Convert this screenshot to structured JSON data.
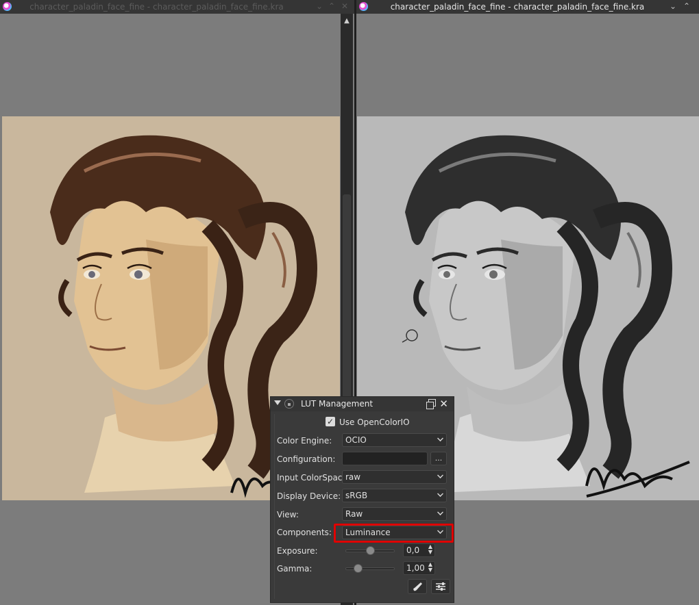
{
  "colors": {
    "accent": "#e00000",
    "titlebar": "#353535",
    "canvas_bg": "#7c7c7c",
    "paper_color": "#c9b79d",
    "paper_gray": "#b9b9b9",
    "panel_bg": "#3a3a3a"
  },
  "left_window": {
    "title": "character_paladin_face_fine - character_paladin_face_fine.kra",
    "app_icon": "krita-logo-icon",
    "buttons": {
      "menu": "⌄",
      "collapse": "⌃",
      "close": "✕"
    }
  },
  "right_window": {
    "title": "character_paladin_face_fine - character_paladin_face_fine.kra",
    "app_icon": "krita-logo-icon",
    "buttons": {
      "menu": "⌄",
      "close": "⌃"
    }
  },
  "lut_panel": {
    "title": "LUT Management",
    "use_ocio": {
      "label": "Use OpenColorIO",
      "checked": true,
      "check_glyph": "✓"
    },
    "rows": {
      "color_engine": {
        "label": "Color Engine:",
        "value": "OCIO"
      },
      "configuration": {
        "label": "Configuration:",
        "value": "",
        "browse_label": "..."
      },
      "input_colorspace": {
        "label": "Input ColorSpace:",
        "value": "raw"
      },
      "display_device": {
        "label": "Display Device:",
        "value": "sRGB"
      },
      "view": {
        "label": "View:",
        "value": "Raw"
      },
      "components": {
        "label": "Components:",
        "value": "Luminance"
      }
    },
    "exposure": {
      "label": "Exposure:",
      "value": "0,0",
      "slider_level": 0.5
    },
    "gamma": {
      "label": "Gamma:",
      "value": "1,00",
      "slider_level": 0.25
    },
    "icons": {
      "brush": "brush-icon",
      "settings": "sliders-icon"
    }
  }
}
